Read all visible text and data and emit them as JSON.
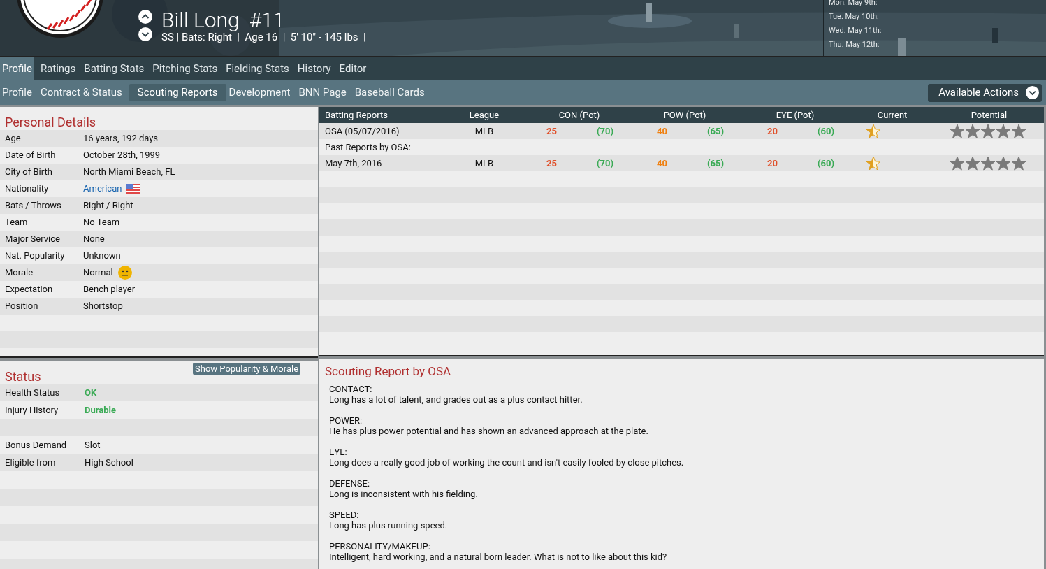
{
  "player": {
    "name": "Bill Long",
    "number": "#11",
    "summary": "SS | Bats: Right  |  Age 16  |  5' 10\" - 145 lbs  |"
  },
  "schedule": [
    "Mon. May 9th:",
    "Tue. May 10th:",
    "Wed. May 11th:",
    "Thu. May 12th:"
  ],
  "main_tabs": [
    {
      "label": "Profile",
      "selected": true
    },
    {
      "label": "Ratings",
      "selected": false
    },
    {
      "label": "Batting Stats",
      "selected": false
    },
    {
      "label": "Pitching Stats",
      "selected": false
    },
    {
      "label": "Fielding Stats",
      "selected": false
    },
    {
      "label": "History",
      "selected": false
    },
    {
      "label": "Editor",
      "selected": false
    }
  ],
  "sub_tabs": [
    {
      "label": "Profile",
      "selected": false
    },
    {
      "label": "Contract & Status",
      "selected": false
    },
    {
      "label": "Scouting Reports",
      "selected": true
    },
    {
      "label": "Development",
      "selected": false
    },
    {
      "label": "BNN Page",
      "selected": false
    },
    {
      "label": "Baseball Cards",
      "selected": false
    }
  ],
  "actions_button": "Available Actions",
  "personal_details": {
    "title": "Personal Details",
    "rows": [
      {
        "label": "Age",
        "value": "16 years, 192 days"
      },
      {
        "label": "Date of Birth",
        "value": "October 28th, 1999"
      },
      {
        "label": "City of Birth",
        "value": "North Miami Beach, FL"
      },
      {
        "label": "Nationality",
        "value": "American",
        "kind": "link-flag"
      },
      {
        "label": "Bats / Throws",
        "value": "Right / Right"
      },
      {
        "label": "Team",
        "value": "No Team"
      },
      {
        "label": "Major Service",
        "value": "None"
      },
      {
        "label": "Nat. Popularity",
        "value": "Unknown"
      },
      {
        "label": "Morale",
        "value": "Normal",
        "kind": "mood"
      },
      {
        "label": "Expectation",
        "value": "Bench player"
      },
      {
        "label": "Position",
        "value": "Shortstop"
      }
    ]
  },
  "status": {
    "title": "Status",
    "button": "Show Popularity & Morale",
    "rows": [
      {
        "label": "Health Status",
        "value": "OK",
        "color": "#3aaa55"
      },
      {
        "label": "Injury History",
        "value": "Durable",
        "color": "#3aaa55"
      },
      null,
      {
        "label": "Bonus Demand",
        "value": "Slot"
      },
      {
        "label": "Eligible from",
        "value": "High School"
      }
    ]
  },
  "reports_table": {
    "columns": [
      "Batting Reports",
      "League",
      "CON (Pot)",
      "POW (Pot)",
      "EYE (Pot)",
      "Current",
      "Potential"
    ],
    "rows": [
      {
        "kind": "report",
        "source": "OSA (05/07/2016)",
        "league": "MLB",
        "ratings": [
          {
            "now": {
              "value": "25",
              "color": "#e0502a"
            },
            "pot": {
              "value": "(70)",
              "color": "#3aaa55"
            }
          },
          {
            "now": {
              "value": "40",
              "color": "#f08010"
            },
            "pot": {
              "value": "(65)",
              "color": "#3aaa55"
            }
          },
          {
            "now": {
              "value": "20",
              "color": "#e0502a"
            },
            "pot": {
              "value": "(60)",
              "color": "#3aaa55"
            }
          }
        ],
        "current": {
          "level": 0.5
        },
        "potential": {
          "stars": 5
        }
      },
      {
        "kind": "heading",
        "source": "Past Reports by OSA:"
      },
      {
        "kind": "report",
        "source": "May 7th, 2016",
        "league": "MLB",
        "ratings": [
          {
            "now": {
              "value": "25",
              "color": "#e0502a"
            },
            "pot": {
              "value": "(70)",
              "color": "#3aaa55"
            }
          },
          {
            "now": {
              "value": "40",
              "color": "#f08010"
            },
            "pot": {
              "value": "(65)",
              "color": "#3aaa55"
            }
          },
          {
            "now": {
              "value": "20",
              "color": "#e0502a"
            },
            "pot": {
              "value": "(60)",
              "color": "#3aaa55"
            }
          }
        ],
        "current": {
          "level": 0.5
        },
        "potential": {
          "stars": 5
        }
      }
    ]
  },
  "scouting_report": {
    "title": "Scouting Report by OSA",
    "sections": [
      {
        "heading": "CONTACT:",
        "text": "Long has a lot of talent, and grades out as a plus contact hitter."
      },
      {
        "heading": "POWER:",
        "text": "He has plus power potential and has shown an advanced approach at the plate."
      },
      {
        "heading": "EYE:",
        "text": "Long does a really good job of working the count and isn't easily fooled by close pitches."
      },
      {
        "heading": "DEFENSE:",
        "text": "Long is inconsistent with his fielding."
      },
      {
        "heading": "SPEED:",
        "text": "Long has plus running speed."
      },
      {
        "heading": "PERSONALITY/MAKEUP:",
        "text": "Intelligent, hard working, and a natural born leader. What is not to like about this kid?"
      }
    ]
  }
}
